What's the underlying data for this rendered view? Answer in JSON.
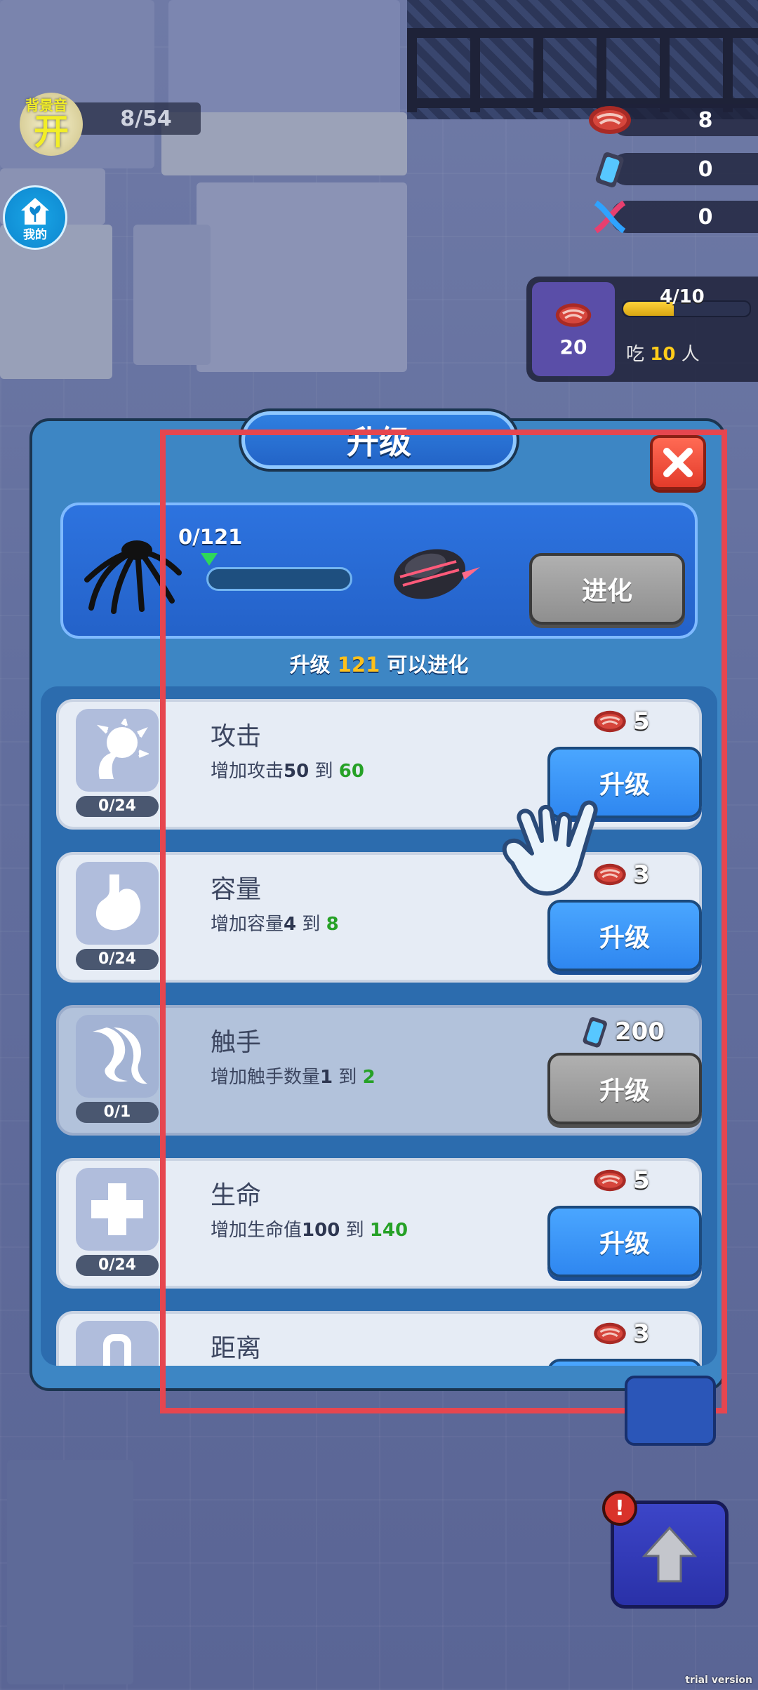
{
  "hud": {
    "counter": "8/54",
    "bgm_label": "背景音",
    "bgm_state": "开",
    "home_label": "我的",
    "resources": [
      {
        "icon": "meat-icon",
        "value": "8"
      },
      {
        "icon": "energy-canister-icon",
        "value": "0"
      },
      {
        "icon": "dna-icon",
        "value": "0"
      }
    ],
    "eat": {
      "count": "20",
      "progress_label": "4/10",
      "progress": 0.4,
      "prefix": "吃",
      "target": "10",
      "suffix": "人"
    }
  },
  "panel": {
    "title": "升级",
    "evolve": {
      "progress_label": "0/121",
      "progress": 0,
      "button": "进化",
      "hint_prefix": "升级",
      "hint_value": "121",
      "hint_suffix": "可以进化"
    },
    "upgrades": [
      {
        "name": "攻击",
        "level": "0/24",
        "desc_prefix": "增加攻击",
        "from": "50",
        "sep": "到",
        "to": "60",
        "cost_icon": "meat-icon",
        "cost": "5",
        "button": "升级",
        "enabled": true,
        "icon": "attack-icon"
      },
      {
        "name": "容量",
        "level": "0/24",
        "desc_prefix": "增加容量",
        "from": "4",
        "sep": "到",
        "to": "8",
        "cost_icon": "meat-icon",
        "cost": "3",
        "button": "升级",
        "enabled": true,
        "icon": "stomach-icon"
      },
      {
        "name": "触手",
        "level": "0/1",
        "desc_prefix": "增加触手数量",
        "from": "1",
        "sep": "到",
        "to": "2",
        "cost_icon": "energy-canister-icon",
        "cost": "200",
        "button": "升级",
        "enabled": false,
        "icon": "tentacle-icon"
      },
      {
        "name": "生命",
        "level": "0/24",
        "desc_prefix": "增加生命值",
        "from": "100",
        "sep": "到",
        "to": "140",
        "cost_icon": "meat-icon",
        "cost": "5",
        "button": "升级",
        "enabled": true,
        "icon": "health-cross-icon"
      },
      {
        "name": "距离",
        "level": "",
        "desc_prefix": "",
        "from": "",
        "sep": "",
        "to": "",
        "cost_icon": "meat-icon",
        "cost": "3",
        "button": "",
        "enabled": true,
        "icon": "range-icon"
      }
    ]
  },
  "alert_mark": "!",
  "watermark": "trial version",
  "colors": {
    "panel_bg": "#3d86c4",
    "button_blue": "#3a95f7",
    "button_gray": "#9f9f9f",
    "highlight_yellow": "#ffc01a",
    "value_green": "#26a126",
    "annotation_red": "#e6464f"
  }
}
